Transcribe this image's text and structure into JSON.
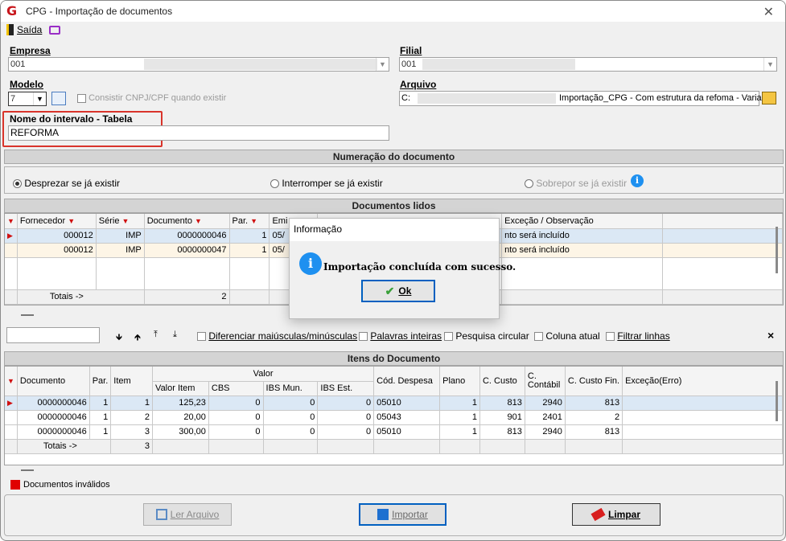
{
  "window": {
    "title": "CPG - Importação de documentos",
    "close": "✕",
    "logo": "G"
  },
  "toolbar": {
    "exit_label": "Saída"
  },
  "empresa": {
    "label": "Empresa",
    "value": "001"
  },
  "filial": {
    "label": "Filial",
    "value": "001"
  },
  "modelo": {
    "label": "Modelo",
    "value": "7",
    "consistir_label": "Consistir CNPJ/CPF quando existir"
  },
  "arquivo": {
    "label": "Arquivo",
    "prefix": "C:",
    "suffix": "Importação_CPG - Com estrutura da refoma - Varia"
  },
  "intervalo": {
    "label": "Nome do intervalo - Tabela",
    "value": "REFORMA"
  },
  "numeracao": {
    "title": "Numeração do documento",
    "options": [
      "Desprezar se já existir",
      "Interromper se já existir",
      "Sobrepor se já existir"
    ],
    "selected": "Desprezar se já existir"
  },
  "docs": {
    "title": "Documentos lidos",
    "headers": [
      "Fornecedor",
      "Série",
      "Documento",
      "Par.",
      "Emi",
      "Exceção / Observação"
    ],
    "rows": [
      {
        "fornecedor": "000012",
        "serie": "IMP",
        "documento": "0000000046",
        "par": "1",
        "emi": "05/",
        "obs": "nto será incluído"
      },
      {
        "fornecedor": "000012",
        "serie": "IMP",
        "documento": "0000000047",
        "par": "1",
        "emi": "05/",
        "obs": "nto será incluído"
      }
    ],
    "totals_label": "Totais ->",
    "totals_value": "2"
  },
  "search": {
    "value": "",
    "options": [
      "Diferenciar maiúsculas/minúsculas",
      "Palavras inteiras",
      "Pesquisa circular",
      "Coluna atual",
      "Filtrar linhas"
    ],
    "close": "×"
  },
  "itens": {
    "title": "Itens do Documento",
    "group_header": "Valor",
    "headers": [
      "Documento",
      "Par.",
      "Item",
      "Valor Item",
      "CBS",
      "IBS Mun.",
      "IBS Est.",
      "Cód. Despesa",
      "Plano",
      "C. Custo",
      "C. Contábil",
      "C. Custo Fin.",
      "Exceção(Erro)"
    ],
    "rows": [
      {
        "documento": "0000000046",
        "par": "1",
        "item": "1",
        "valor": "125,23",
        "cbs": "0",
        "ibsmun": "0",
        "ibsest": "0",
        "despesa": "05010",
        "plano": "1",
        "ccusto": "813",
        "contabil": "2940",
        "custofin": "813"
      },
      {
        "documento": "0000000046",
        "par": "1",
        "item": "2",
        "valor": "20,00",
        "cbs": "0",
        "ibsmun": "0",
        "ibsest": "0",
        "despesa": "05043",
        "plano": "1",
        "ccusto": "901",
        "contabil": "2401",
        "custofin": "2"
      },
      {
        "documento": "0000000046",
        "par": "1",
        "item": "3",
        "valor": "300,00",
        "cbs": "0",
        "ibsmun": "0",
        "ibsest": "0",
        "despesa": "05010",
        "plano": "1",
        "ccusto": "813",
        "contabil": "2940",
        "custofin": "813"
      }
    ],
    "totals_label": "Totais ->",
    "totals_value": "3"
  },
  "legend": {
    "invalid_label": "Documentos inválidos",
    "invalid_color": "#e00000"
  },
  "buttons": {
    "ler": "Ler Arquivo",
    "importar": "Importar",
    "limpar": "Limpar"
  },
  "dialog": {
    "title": "Informação",
    "message": "Importação concluída com sucesso.",
    "ok": "Ok"
  },
  "colors": {
    "highlight": "#d9342b",
    "selected_row": "#dbe8f5",
    "info": "#1e90f0"
  }
}
